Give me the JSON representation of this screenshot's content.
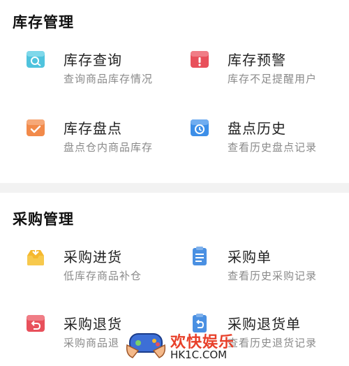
{
  "inventory": {
    "title": "库存管理",
    "items": [
      {
        "label": "库存查询",
        "sub": "查询商品库存情况",
        "icon": "search-box-icon",
        "color": "#4fc3dd"
      },
      {
        "label": "库存预警",
        "sub": "库存不足提醒用户",
        "icon": "alert-box-icon",
        "color": "#e8505b"
      },
      {
        "label": "库存盘点",
        "sub": "盘点仓内商品库存",
        "icon": "check-box-icon",
        "color": "#f28a4a"
      },
      {
        "label": "盘点历史",
        "sub": "查看历史盘点记录",
        "icon": "clock-box-icon",
        "color": "#3d8fe8"
      }
    ]
  },
  "purchase": {
    "title": "采购管理",
    "items": [
      {
        "label": "采购进货",
        "sub": "低库存商品补仓",
        "icon": "inbox-download-icon",
        "color": "#f5b82e"
      },
      {
        "label": "采购单",
        "sub": "查看历史采购记录",
        "icon": "clipboard-icon",
        "color": "#4a90e2"
      },
      {
        "label": "采购退货",
        "sub": "采购商品退",
        "icon": "return-box-icon",
        "color": "#e8505b"
      },
      {
        "label": "采购退货单",
        "sub": "查看历史退货记录",
        "icon": "return-clipboard-icon",
        "color": "#4a90e2"
      }
    ]
  },
  "watermark": {
    "title": "欢快娱乐",
    "url": "HK1C.COM"
  }
}
